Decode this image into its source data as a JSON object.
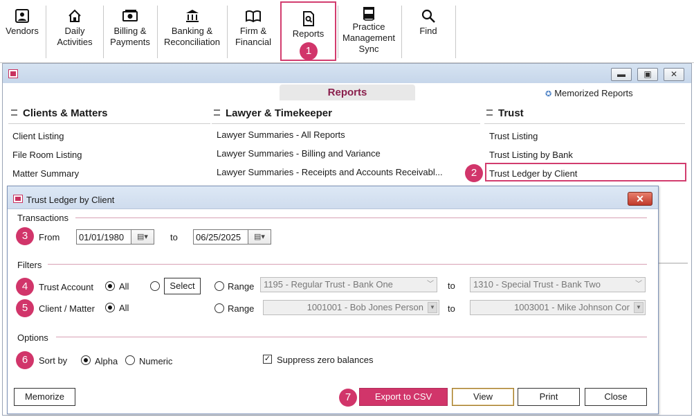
{
  "toolbar": {
    "vendors": "Vendors",
    "daily": "Daily\nActivities",
    "billing": "Billing &\nPayments",
    "banking": "Banking &\nReconciliation",
    "firm": "Firm &\nFinancial",
    "reports": "Reports",
    "practice": "Practice\nManagement\nSync",
    "find": "Find"
  },
  "steps": [
    "1",
    "2",
    "3",
    "4",
    "5",
    "6",
    "7"
  ],
  "reports_window": {
    "tab": "Reports",
    "memorized": "Memorized Reports",
    "columns": [
      {
        "title": "Clients & Matters",
        "items": [
          "Client Listing",
          "File Room Listing",
          "Matter Summary"
        ]
      },
      {
        "title": "Lawyer & Timekeeper",
        "items": [
          "Lawyer Summaries - All Reports",
          "Lawyer Summaries - Billing and Variance",
          "Lawyer Summaries - Receipts and Accounts Receivabl..."
        ]
      },
      {
        "title": "Trust",
        "items": [
          "Trust Listing",
          "Trust Listing by Bank",
          "Trust Ledger by Client"
        ]
      }
    ]
  },
  "dialog": {
    "title": "Trust Ledger by Client",
    "transactions": "Transactions",
    "from_label": "From",
    "from_value": "01/01/1980",
    "to_label": "to",
    "to_value": "06/25/2025",
    "filters": "Filters",
    "trust_account_label": "Trust Account",
    "all": "All",
    "select": "Select",
    "range": "Range",
    "trust_from": "1195 - Regular Trust - Bank One",
    "trust_to": "1310 - Special Trust - Bank Two",
    "client_matter_label": "Client / Matter",
    "client_from": "1001001 - Bob Jones Person",
    "client_to": "1003001 - Mike Johnson Cor",
    "options": "Options",
    "sort_by": "Sort by",
    "alpha": "Alpha",
    "numeric": "Numeric",
    "suppress": "Suppress zero balances",
    "buttons": {
      "memorize": "Memorize",
      "export": "Export to CSV",
      "view": "View",
      "print": "Print",
      "close": "Close"
    }
  },
  "colors": {
    "accent": "#d1356a",
    "tab_text": "#8a1f4c"
  }
}
